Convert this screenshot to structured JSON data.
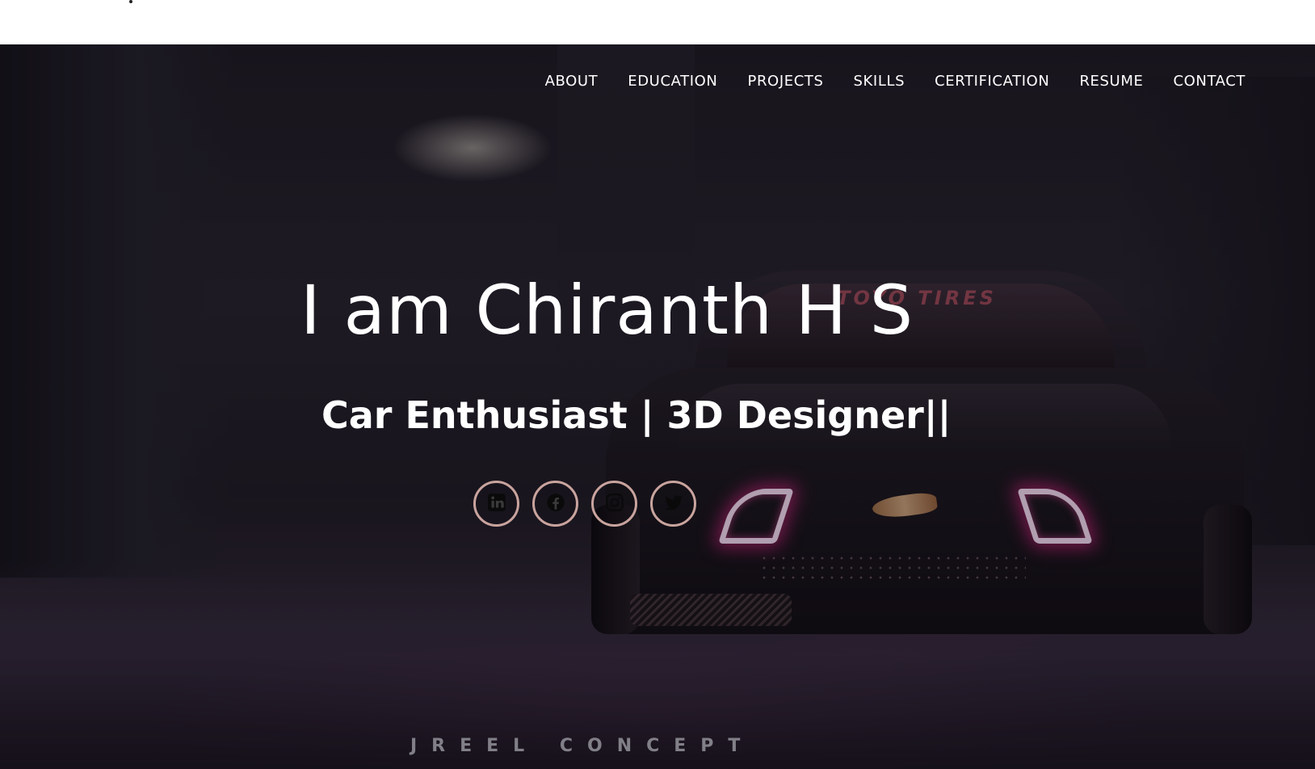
{
  "nav": {
    "items": [
      {
        "label": "ABOUT"
      },
      {
        "label": "EDUCATION"
      },
      {
        "label": "PROJECTS"
      },
      {
        "label": "SKILLS"
      },
      {
        "label": "CERTIFICATION"
      },
      {
        "label": "RESUME"
      },
      {
        "label": "CONTACT"
      }
    ]
  },
  "hero": {
    "title": "I am Chiranth H S",
    "subtitle": "Car Enthusiast | 3D Designer||",
    "watermark": "JREEL CONCEPT",
    "car_banner": "TOYO TIRES"
  },
  "socials": [
    {
      "icon": "linkedin-icon"
    },
    {
      "icon": "facebook-icon"
    },
    {
      "icon": "instagram-icon"
    },
    {
      "icon": "twitter-icon"
    }
  ],
  "colors": {
    "text": "#ffffff",
    "social_border": "#c9a49e",
    "taillight_glow": "#ff2896"
  }
}
